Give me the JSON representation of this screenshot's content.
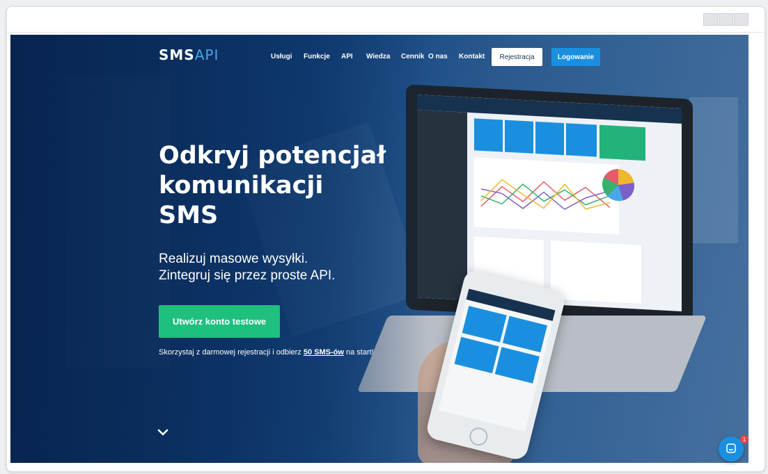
{
  "brand": {
    "logo_main": "SMS",
    "logo_api": "API"
  },
  "nav": {
    "items": [
      "Usługi",
      "Funkcje",
      "API",
      "Wiedza",
      "Cennik",
      "O nas",
      "Kontakt"
    ],
    "register_label": "Rejestracja",
    "login_label": "Logowanie"
  },
  "hero": {
    "headline_line1": "Odkryj potencjał",
    "headline_line2": "komunikacji",
    "headline_line3": "SMS",
    "sub_line1": "Realizuj masowe wysyłki.",
    "sub_line2": "Zintegruj się przez proste API.",
    "cta_label": "Utwórz konto testowe",
    "note_prefix": "Skorzystaj z darmowej rejestracji i odbierz ",
    "note_link": "50 SMS-ów",
    "note_suffix": " na start!"
  },
  "chat": {
    "badge": "1"
  },
  "colors": {
    "accent": "#1b8fdf",
    "cta": "#1fbf7d",
    "hero": "#0b2f63"
  },
  "icons": [
    "chevron-down-icon",
    "chat-icon",
    "window-button-icon"
  ]
}
